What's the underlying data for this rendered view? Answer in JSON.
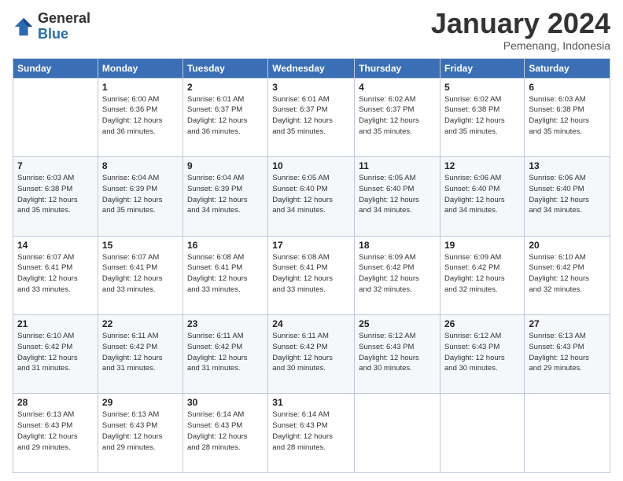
{
  "logo": {
    "general": "General",
    "blue": "Blue"
  },
  "header": {
    "month": "January 2024",
    "location": "Pemenang, Indonesia"
  },
  "days_of_week": [
    "Sunday",
    "Monday",
    "Tuesday",
    "Wednesday",
    "Thursday",
    "Friday",
    "Saturday"
  ],
  "weeks": [
    [
      {
        "day": "",
        "info": ""
      },
      {
        "day": "1",
        "info": "Sunrise: 6:00 AM\nSunset: 6:36 PM\nDaylight: 12 hours\nand 36 minutes."
      },
      {
        "day": "2",
        "info": "Sunrise: 6:01 AM\nSunset: 6:37 PM\nDaylight: 12 hours\nand 36 minutes."
      },
      {
        "day": "3",
        "info": "Sunrise: 6:01 AM\nSunset: 6:37 PM\nDaylight: 12 hours\nand 35 minutes."
      },
      {
        "day": "4",
        "info": "Sunrise: 6:02 AM\nSunset: 6:37 PM\nDaylight: 12 hours\nand 35 minutes."
      },
      {
        "day": "5",
        "info": "Sunrise: 6:02 AM\nSunset: 6:38 PM\nDaylight: 12 hours\nand 35 minutes."
      },
      {
        "day": "6",
        "info": "Sunrise: 6:03 AM\nSunset: 6:38 PM\nDaylight: 12 hours\nand 35 minutes."
      }
    ],
    [
      {
        "day": "7",
        "info": "Sunrise: 6:03 AM\nSunset: 6:38 PM\nDaylight: 12 hours\nand 35 minutes."
      },
      {
        "day": "8",
        "info": "Sunrise: 6:04 AM\nSunset: 6:39 PM\nDaylight: 12 hours\nand 35 minutes."
      },
      {
        "day": "9",
        "info": "Sunrise: 6:04 AM\nSunset: 6:39 PM\nDaylight: 12 hours\nand 34 minutes."
      },
      {
        "day": "10",
        "info": "Sunrise: 6:05 AM\nSunset: 6:40 PM\nDaylight: 12 hours\nand 34 minutes."
      },
      {
        "day": "11",
        "info": "Sunrise: 6:05 AM\nSunset: 6:40 PM\nDaylight: 12 hours\nand 34 minutes."
      },
      {
        "day": "12",
        "info": "Sunrise: 6:06 AM\nSunset: 6:40 PM\nDaylight: 12 hours\nand 34 minutes."
      },
      {
        "day": "13",
        "info": "Sunrise: 6:06 AM\nSunset: 6:40 PM\nDaylight: 12 hours\nand 34 minutes."
      }
    ],
    [
      {
        "day": "14",
        "info": "Sunrise: 6:07 AM\nSunset: 6:41 PM\nDaylight: 12 hours\nand 33 minutes."
      },
      {
        "day": "15",
        "info": "Sunrise: 6:07 AM\nSunset: 6:41 PM\nDaylight: 12 hours\nand 33 minutes."
      },
      {
        "day": "16",
        "info": "Sunrise: 6:08 AM\nSunset: 6:41 PM\nDaylight: 12 hours\nand 33 minutes."
      },
      {
        "day": "17",
        "info": "Sunrise: 6:08 AM\nSunset: 6:41 PM\nDaylight: 12 hours\nand 33 minutes."
      },
      {
        "day": "18",
        "info": "Sunrise: 6:09 AM\nSunset: 6:42 PM\nDaylight: 12 hours\nand 32 minutes."
      },
      {
        "day": "19",
        "info": "Sunrise: 6:09 AM\nSunset: 6:42 PM\nDaylight: 12 hours\nand 32 minutes."
      },
      {
        "day": "20",
        "info": "Sunrise: 6:10 AM\nSunset: 6:42 PM\nDaylight: 12 hours\nand 32 minutes."
      }
    ],
    [
      {
        "day": "21",
        "info": "Sunrise: 6:10 AM\nSunset: 6:42 PM\nDaylight: 12 hours\nand 31 minutes."
      },
      {
        "day": "22",
        "info": "Sunrise: 6:11 AM\nSunset: 6:42 PM\nDaylight: 12 hours\nand 31 minutes."
      },
      {
        "day": "23",
        "info": "Sunrise: 6:11 AM\nSunset: 6:42 PM\nDaylight: 12 hours\nand 31 minutes."
      },
      {
        "day": "24",
        "info": "Sunrise: 6:11 AM\nSunset: 6:42 PM\nDaylight: 12 hours\nand 30 minutes."
      },
      {
        "day": "25",
        "info": "Sunrise: 6:12 AM\nSunset: 6:43 PM\nDaylight: 12 hours\nand 30 minutes."
      },
      {
        "day": "26",
        "info": "Sunrise: 6:12 AM\nSunset: 6:43 PM\nDaylight: 12 hours\nand 30 minutes."
      },
      {
        "day": "27",
        "info": "Sunrise: 6:13 AM\nSunset: 6:43 PM\nDaylight: 12 hours\nand 29 minutes."
      }
    ],
    [
      {
        "day": "28",
        "info": "Sunrise: 6:13 AM\nSunset: 6:43 PM\nDaylight: 12 hours\nand 29 minutes."
      },
      {
        "day": "29",
        "info": "Sunrise: 6:13 AM\nSunset: 6:43 PM\nDaylight: 12 hours\nand 29 minutes."
      },
      {
        "day": "30",
        "info": "Sunrise: 6:14 AM\nSunset: 6:43 PM\nDaylight: 12 hours\nand 28 minutes."
      },
      {
        "day": "31",
        "info": "Sunrise: 6:14 AM\nSunset: 6:43 PM\nDaylight: 12 hours\nand 28 minutes."
      },
      {
        "day": "",
        "info": ""
      },
      {
        "day": "",
        "info": ""
      },
      {
        "day": "",
        "info": ""
      }
    ]
  ]
}
